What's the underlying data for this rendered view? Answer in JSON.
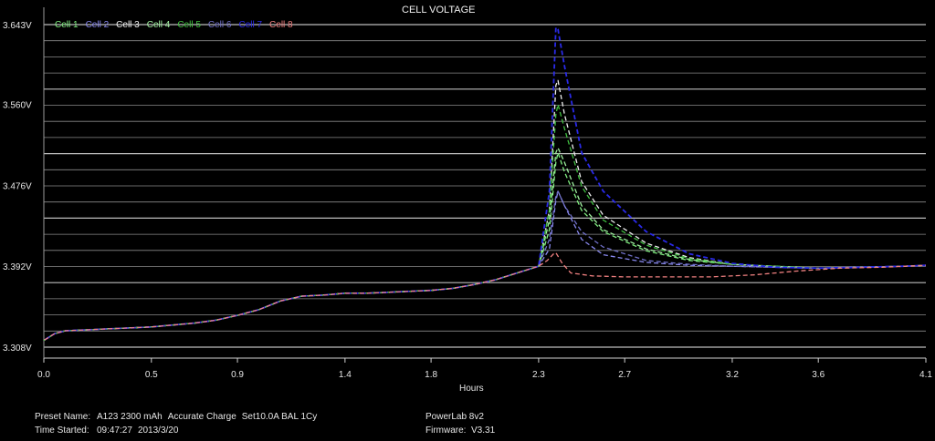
{
  "chart_data": {
    "type": "line",
    "title": "CELL VOLTAGE",
    "xlabel": "Hours",
    "ylabel": "",
    "xlim": [
      0.0,
      4.1
    ],
    "ylim": [
      3.308,
      3.643
    ],
    "x_ticks": [
      "0.0",
      "0.5",
      "0.9",
      "1.4",
      "1.8",
      "2.3",
      "2.7",
      "3.2",
      "3.6",
      "4.1"
    ],
    "y_ticks": [
      "3.308V",
      "3.392V",
      "3.476V",
      "3.560V",
      "3.643V"
    ],
    "y_tick_values": [
      3.308,
      3.392,
      3.476,
      3.56,
      3.643
    ],
    "grid": true,
    "legend_placement": "top-left",
    "common": {
      "x": [
        0.0,
        0.05,
        0.1,
        0.2,
        0.3,
        0.4,
        0.5,
        0.6,
        0.7,
        0.8,
        0.9,
        1.0,
        1.1,
        1.2,
        1.3,
        1.4,
        1.5,
        1.6,
        1.7,
        1.8,
        1.9,
        2.0,
        2.1,
        2.2,
        2.3
      ],
      "y": [
        3.315,
        3.322,
        3.325,
        3.326,
        3.327,
        3.328,
        3.329,
        3.331,
        3.333,
        3.336,
        3.341,
        3.347,
        3.356,
        3.361,
        3.362,
        3.364,
        3.364,
        3.365,
        3.366,
        3.367,
        3.369,
        3.373,
        3.378,
        3.385,
        3.392
      ]
    },
    "series": [
      {
        "name": "Cell 1",
        "color": "#80f080",
        "x": [
          2.3,
          2.35,
          2.38,
          2.39,
          2.42,
          2.5,
          2.6,
          2.8,
          3.0,
          3.2,
          3.4,
          3.6,
          3.8,
          4.0,
          4.1
        ],
        "y": [
          3.392,
          3.43,
          3.5,
          3.51,
          3.49,
          3.45,
          3.428,
          3.408,
          3.398,
          3.394,
          3.392,
          3.39,
          3.391,
          3.392,
          3.393
        ]
      },
      {
        "name": "Cell 2",
        "color": "#8888ee",
        "x": [
          2.3,
          2.35,
          2.38,
          2.39,
          2.42,
          2.5,
          2.6,
          2.8,
          3.0,
          3.2,
          3.4,
          3.6,
          3.8,
          4.0,
          4.1
        ],
        "y": [
          3.392,
          3.41,
          3.46,
          3.47,
          3.455,
          3.42,
          3.404,
          3.396,
          3.393,
          3.392,
          3.391,
          3.39,
          3.391,
          3.392,
          3.393
        ]
      },
      {
        "name": "Cell 3",
        "color": "#f0f0f0",
        "x": [
          2.3,
          2.35,
          2.38,
          2.39,
          2.42,
          2.5,
          2.6,
          2.8,
          3.0,
          3.2,
          3.4,
          3.6,
          3.8,
          4.0,
          4.1
        ],
        "y": [
          3.392,
          3.45,
          3.58,
          3.585,
          3.55,
          3.48,
          3.445,
          3.416,
          3.401,
          3.394,
          3.391,
          3.39,
          3.391,
          3.392,
          3.393
        ]
      },
      {
        "name": "Cell 4",
        "color": "#a0f0a0",
        "x": [
          2.3,
          2.35,
          2.38,
          2.39,
          2.42,
          2.5,
          2.6,
          2.8,
          3.0,
          3.2,
          3.4,
          3.6,
          3.8,
          4.0,
          4.1
        ],
        "y": [
          3.392,
          3.44,
          3.51,
          3.515,
          3.5,
          3.455,
          3.43,
          3.41,
          3.399,
          3.394,
          3.392,
          3.39,
          3.391,
          3.392,
          3.393
        ]
      },
      {
        "name": "Cell 5",
        "color": "#40c040",
        "x": [
          2.3,
          2.35,
          2.38,
          2.39,
          2.42,
          2.5,
          2.6,
          2.8,
          3.0,
          3.2,
          3.4,
          3.6,
          3.8,
          4.0,
          4.1
        ],
        "y": [
          3.392,
          3.45,
          3.55,
          3.56,
          3.535,
          3.475,
          3.44,
          3.414,
          3.4,
          3.394,
          3.392,
          3.39,
          3.391,
          3.392,
          3.393
        ]
      },
      {
        "name": "Cell 6",
        "color": "#7070c8",
        "x": [
          2.3,
          2.35,
          2.38,
          2.39,
          2.42,
          2.5,
          2.6,
          2.8,
          3.0,
          3.2,
          3.4,
          3.6,
          3.8,
          4.0,
          4.1
        ],
        "y": [
          3.392,
          3.42,
          3.465,
          3.47,
          3.455,
          3.428,
          3.412,
          3.398,
          3.394,
          3.392,
          3.391,
          3.39,
          3.391,
          3.392,
          3.393
        ]
      },
      {
        "name": "Cell 7",
        "color": "#2a2ae8",
        "x": [
          2.3,
          2.35,
          2.38,
          2.39,
          2.42,
          2.5,
          2.6,
          2.8,
          3.0,
          3.2,
          3.4,
          3.6,
          3.8,
          4.0,
          4.1
        ],
        "y": [
          3.392,
          3.47,
          3.64,
          3.638,
          3.6,
          3.51,
          3.47,
          3.428,
          3.405,
          3.395,
          3.391,
          3.39,
          3.391,
          3.392,
          3.393
        ]
      },
      {
        "name": "Cell 8",
        "color": "#f08080",
        "x": [
          2.3,
          2.34,
          2.37,
          2.38,
          2.41,
          2.45,
          2.55,
          2.7,
          2.9,
          3.1,
          3.3,
          3.5,
          3.7,
          3.9,
          4.1
        ],
        "y": [
          3.392,
          3.398,
          3.405,
          3.406,
          3.395,
          3.385,
          3.382,
          3.381,
          3.381,
          3.381,
          3.383,
          3.387,
          3.39,
          3.391,
          3.393
        ]
      }
    ]
  },
  "footer": {
    "preset_label": "Preset Name:",
    "preset_value": "A123 2300 mAh",
    "mode_value": "Accurate Charge",
    "settings_value": "Set10.0A BAL 1Cy",
    "time_label": "Time Started:",
    "time_value": "09:47:27",
    "date_value": "2013/3/20",
    "device_value": "PowerLab 8v2",
    "firmware_label": "Firmware:",
    "firmware_value": "V3.31"
  }
}
